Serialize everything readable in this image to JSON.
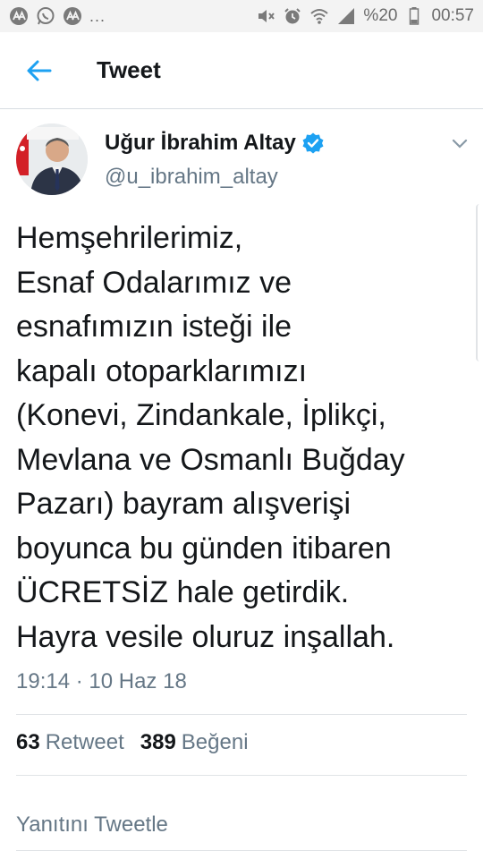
{
  "status_bar": {
    "left_icons": [
      "aa-news-icon",
      "whatsapp-icon",
      "aa-news-icon"
    ],
    "more": "...",
    "right_icons": [
      "mute-icon",
      "alarm-icon",
      "wifi-icon",
      "signal-icon"
    ],
    "battery_percent": "%20",
    "time": "00:57"
  },
  "app_bar": {
    "back_icon": "arrow-left-icon",
    "title": "Tweet"
  },
  "tweet": {
    "author_name": "Uğur İbrahim Altay",
    "handle": "@u_ibrahim_altay",
    "verified": true,
    "text_lines": [
      "Hemşehrilerimiz,",
      "Esnaf Odalarımız ve",
      "esnafımızın isteği ile",
      "kapalı otoparklarımızı",
      "(Konevi, Zindankale, İplikçi,",
      "Mevlana ve Osmanlı Buğday",
      "Pazarı) bayram alışverişi",
      "boyunca bu günden itibaren",
      "ÜCRETSİZ hale getirdik.",
      "Hayra vesile oluruz inşallah."
    ],
    "timestamp": "19:14 · 10 Haz 18"
  },
  "stats": {
    "retweet_count": "63",
    "retweet_label": "Retweet",
    "like_count": "389",
    "like_label": "Beğeni"
  },
  "reply": {
    "placeholder": "Yanıtını Tweetle"
  },
  "colors": {
    "accent": "#1da1f2",
    "text": "#14171a",
    "muted": "#657786",
    "divider": "#e1e4e7"
  }
}
